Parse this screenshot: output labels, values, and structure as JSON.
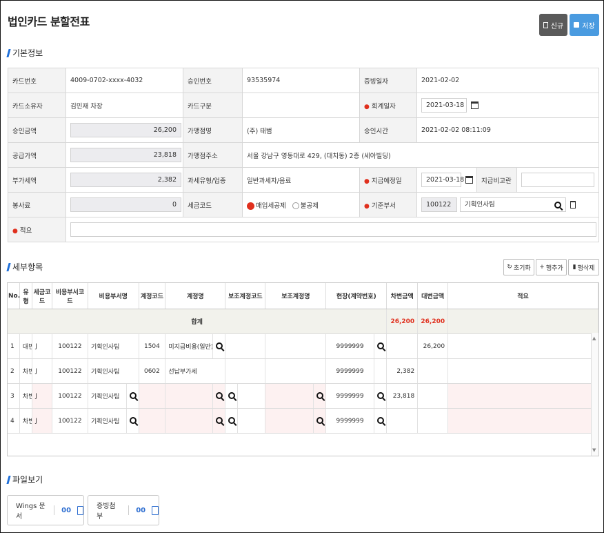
{
  "header": {
    "title": "법인카드 분할전표",
    "new_label": "신규",
    "save_label": "저장"
  },
  "basic": {
    "section_title": "기본정보",
    "card_no_label": "카드번호",
    "card_no": "4009-0702-xxxx-4032",
    "approval_no_label": "승인번호",
    "approval_no": "93535974",
    "proof_date_label": "증빙일자",
    "proof_date": "2021-02-02",
    "card_owner_label": "카드소유자",
    "card_owner": "김민재 차장",
    "card_type_label": "카드구분",
    "card_type": "",
    "acct_date_label": "회계일자",
    "acct_date": "2021-03-18",
    "approved_amt_label": "승인금액",
    "approved_amt": "26,200",
    "merchant_label": "가맹점명",
    "merchant": "(주) 태범",
    "approval_time_label": "승인시간",
    "approval_time": "2021-02-02 08:11:09",
    "supply_amt_label": "공급가액",
    "supply_amt": "23,818",
    "merchant_addr_label": "가맹점주소",
    "merchant_addr": "서울 강남구 영동대로 429, (대치동) 2층 (세아빌딩)",
    "vat_label": "부가세액",
    "vat": "2,382",
    "tax_type_label": "과세유형/업종",
    "tax_type": "일반과세자/음료",
    "pay_date_label": "지급예정일",
    "pay_date": "2021-03-18",
    "pay_note_label": "지급비고란",
    "pay_note": "",
    "service_label": "봉사료",
    "service": "0",
    "tax_code_label": "세금코드",
    "tax_opt1": "매입세공제",
    "tax_opt2": "불공제",
    "dept_label": "기준부서",
    "dept_code": "100122",
    "dept_name": "기획인사팀",
    "memo_label": "적요",
    "memo": ""
  },
  "detail": {
    "section_title": "세부항목",
    "reset_label": "초기화",
    "add_label": "행추가",
    "delete_label": "행삭제",
    "columns": [
      "No.",
      "유형",
      "세금코드",
      "비용부서코드",
      "비용부서명",
      "계정코드",
      "계정명",
      "보조계정코드",
      "보조계정명",
      "현장(계약번호)",
      "차변금액",
      "대변금액",
      "적요"
    ],
    "sum_label": "합계",
    "sum_debit": "26,200",
    "sum_credit": "26,200",
    "rows": [
      {
        "no": "1",
        "type": "대변",
        "tax": "J",
        "dept_code": "100122",
        "dept_name": "기획인사팀",
        "acct_code": "1504",
        "acct_name": "미지급비용(일반)",
        "site": "9999999",
        "debit": "",
        "credit": "26,200"
      },
      {
        "no": "2",
        "type": "차변",
        "tax": "J",
        "dept_code": "100122",
        "dept_name": "기획인사팀",
        "acct_code": "0602",
        "acct_name": "선납부가세",
        "site": "9999999",
        "debit": "2,382",
        "credit": ""
      },
      {
        "no": "3",
        "type": "차변",
        "tax": "J",
        "dept_code": "100122",
        "dept_name": "기획인사팀",
        "acct_code": "",
        "acct_name": "",
        "site": "9999999",
        "debit": "23,818",
        "credit": ""
      },
      {
        "no": "4",
        "type": "차변",
        "tax": "J",
        "dept_code": "100122",
        "dept_name": "기획인사팀",
        "acct_code": "",
        "acct_name": "",
        "site": "9999999",
        "debit": "",
        "credit": ""
      }
    ]
  },
  "files": {
    "section_title": "파일보기",
    "wings_label": "Wings 문서",
    "wings_count": "00",
    "proof_label": "증빙첨부",
    "proof_count": "00"
  }
}
